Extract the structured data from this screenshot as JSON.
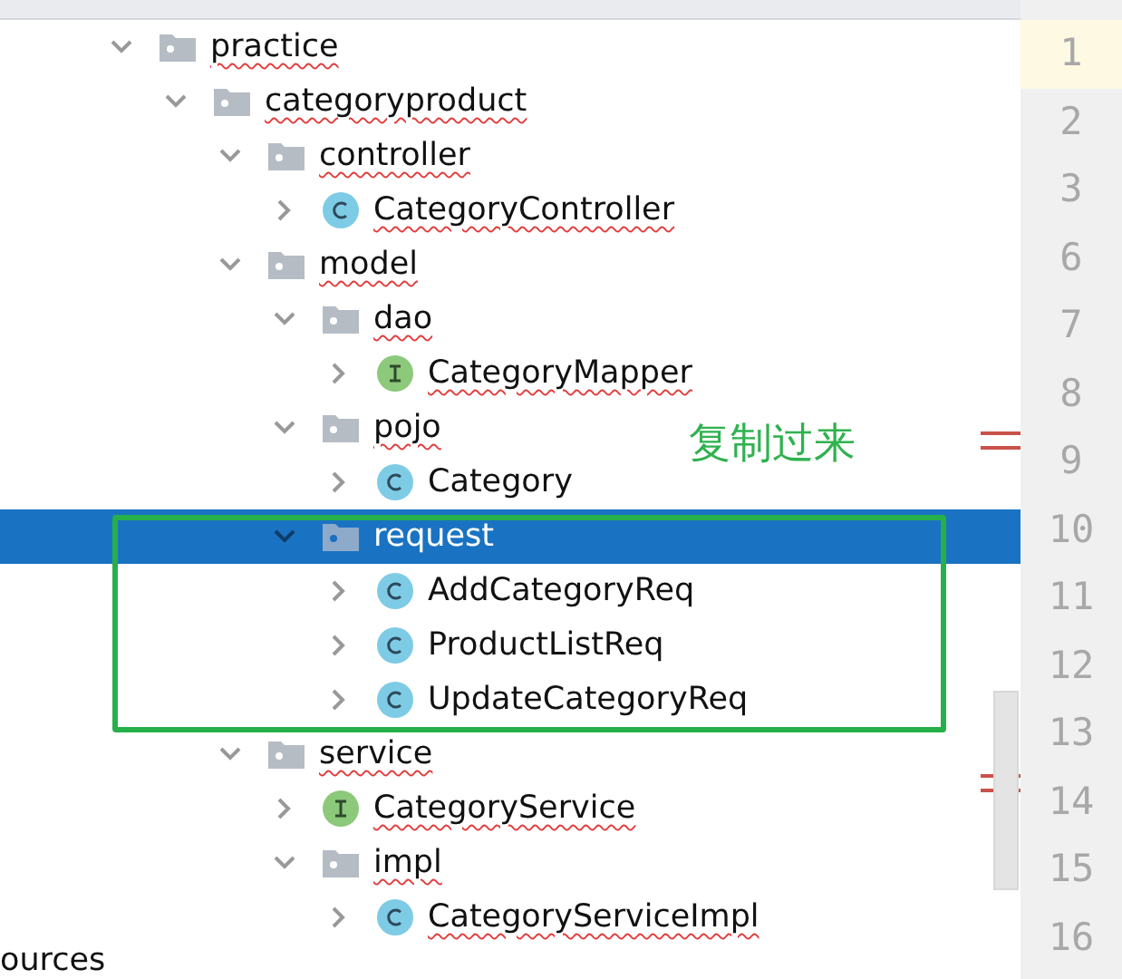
{
  "tree": [
    {
      "label": "practice",
      "kind": "folder",
      "expanded": true,
      "selected": false,
      "error": true,
      "children": [
        {
          "label": "categoryproduct",
          "kind": "folder",
          "expanded": true,
          "selected": false,
          "error": true,
          "children": [
            {
              "label": "controller",
              "kind": "folder",
              "expanded": true,
              "selected": false,
              "error": true,
              "children": [
                {
                  "label": "CategoryController",
                  "kind": "class",
                  "expanded": false,
                  "selected": false,
                  "error": true
                }
              ]
            },
            {
              "label": "model",
              "kind": "folder",
              "expanded": true,
              "selected": false,
              "error": true,
              "children": [
                {
                  "label": "dao",
                  "kind": "folder",
                  "expanded": true,
                  "selected": false,
                  "error": true,
                  "children": [
                    {
                      "label": "CategoryMapper",
                      "kind": "interface",
                      "expanded": false,
                      "selected": false,
                      "error": true
                    }
                  ]
                },
                {
                  "label": "pojo",
                  "kind": "folder",
                  "expanded": true,
                  "selected": false,
                  "error": true,
                  "children": [
                    {
                      "label": "Category",
                      "kind": "class",
                      "expanded": false,
                      "selected": false,
                      "error": false
                    }
                  ]
                },
                {
                  "label": "request",
                  "kind": "folder",
                  "expanded": true,
                  "selected": true,
                  "error": false,
                  "children": [
                    {
                      "label": "AddCategoryReq",
                      "kind": "class",
                      "expanded": false,
                      "selected": false,
                      "error": false
                    },
                    {
                      "label": "ProductListReq",
                      "kind": "class",
                      "expanded": false,
                      "selected": false,
                      "error": false
                    },
                    {
                      "label": "UpdateCategoryReq",
                      "kind": "class",
                      "expanded": false,
                      "selected": false,
                      "error": false
                    }
                  ]
                }
              ]
            },
            {
              "label": "service",
              "kind": "folder",
              "expanded": true,
              "selected": false,
              "error": true,
              "children": [
                {
                  "label": "CategoryService",
                  "kind": "interface",
                  "expanded": false,
                  "selected": false,
                  "error": true
                },
                {
                  "label": "impl",
                  "kind": "folder",
                  "expanded": true,
                  "selected": false,
                  "error": true,
                  "children": [
                    {
                      "label": "CategoryServiceImpl",
                      "kind": "class",
                      "expanded": false,
                      "selected": false,
                      "error": true
                    }
                  ]
                }
              ]
            }
          ]
        }
      ]
    }
  ],
  "cut_row": "ources",
  "annotation": {
    "text": "复制过来"
  },
  "gutter": [
    {
      "number": "1",
      "current": true
    },
    {
      "number": "2",
      "current": false
    },
    {
      "number": "3",
      "current": false
    },
    {
      "number": "6",
      "current": false
    },
    {
      "number": "7",
      "current": false
    },
    {
      "number": "8",
      "current": false
    },
    {
      "number": "9",
      "current": false
    },
    {
      "number": "10",
      "current": false
    },
    {
      "number": "11",
      "current": false
    },
    {
      "number": "12",
      "current": false
    },
    {
      "number": "13",
      "current": false
    },
    {
      "number": "14",
      "current": false
    },
    {
      "number": "15",
      "current": false
    },
    {
      "number": "16",
      "current": false
    }
  ]
}
